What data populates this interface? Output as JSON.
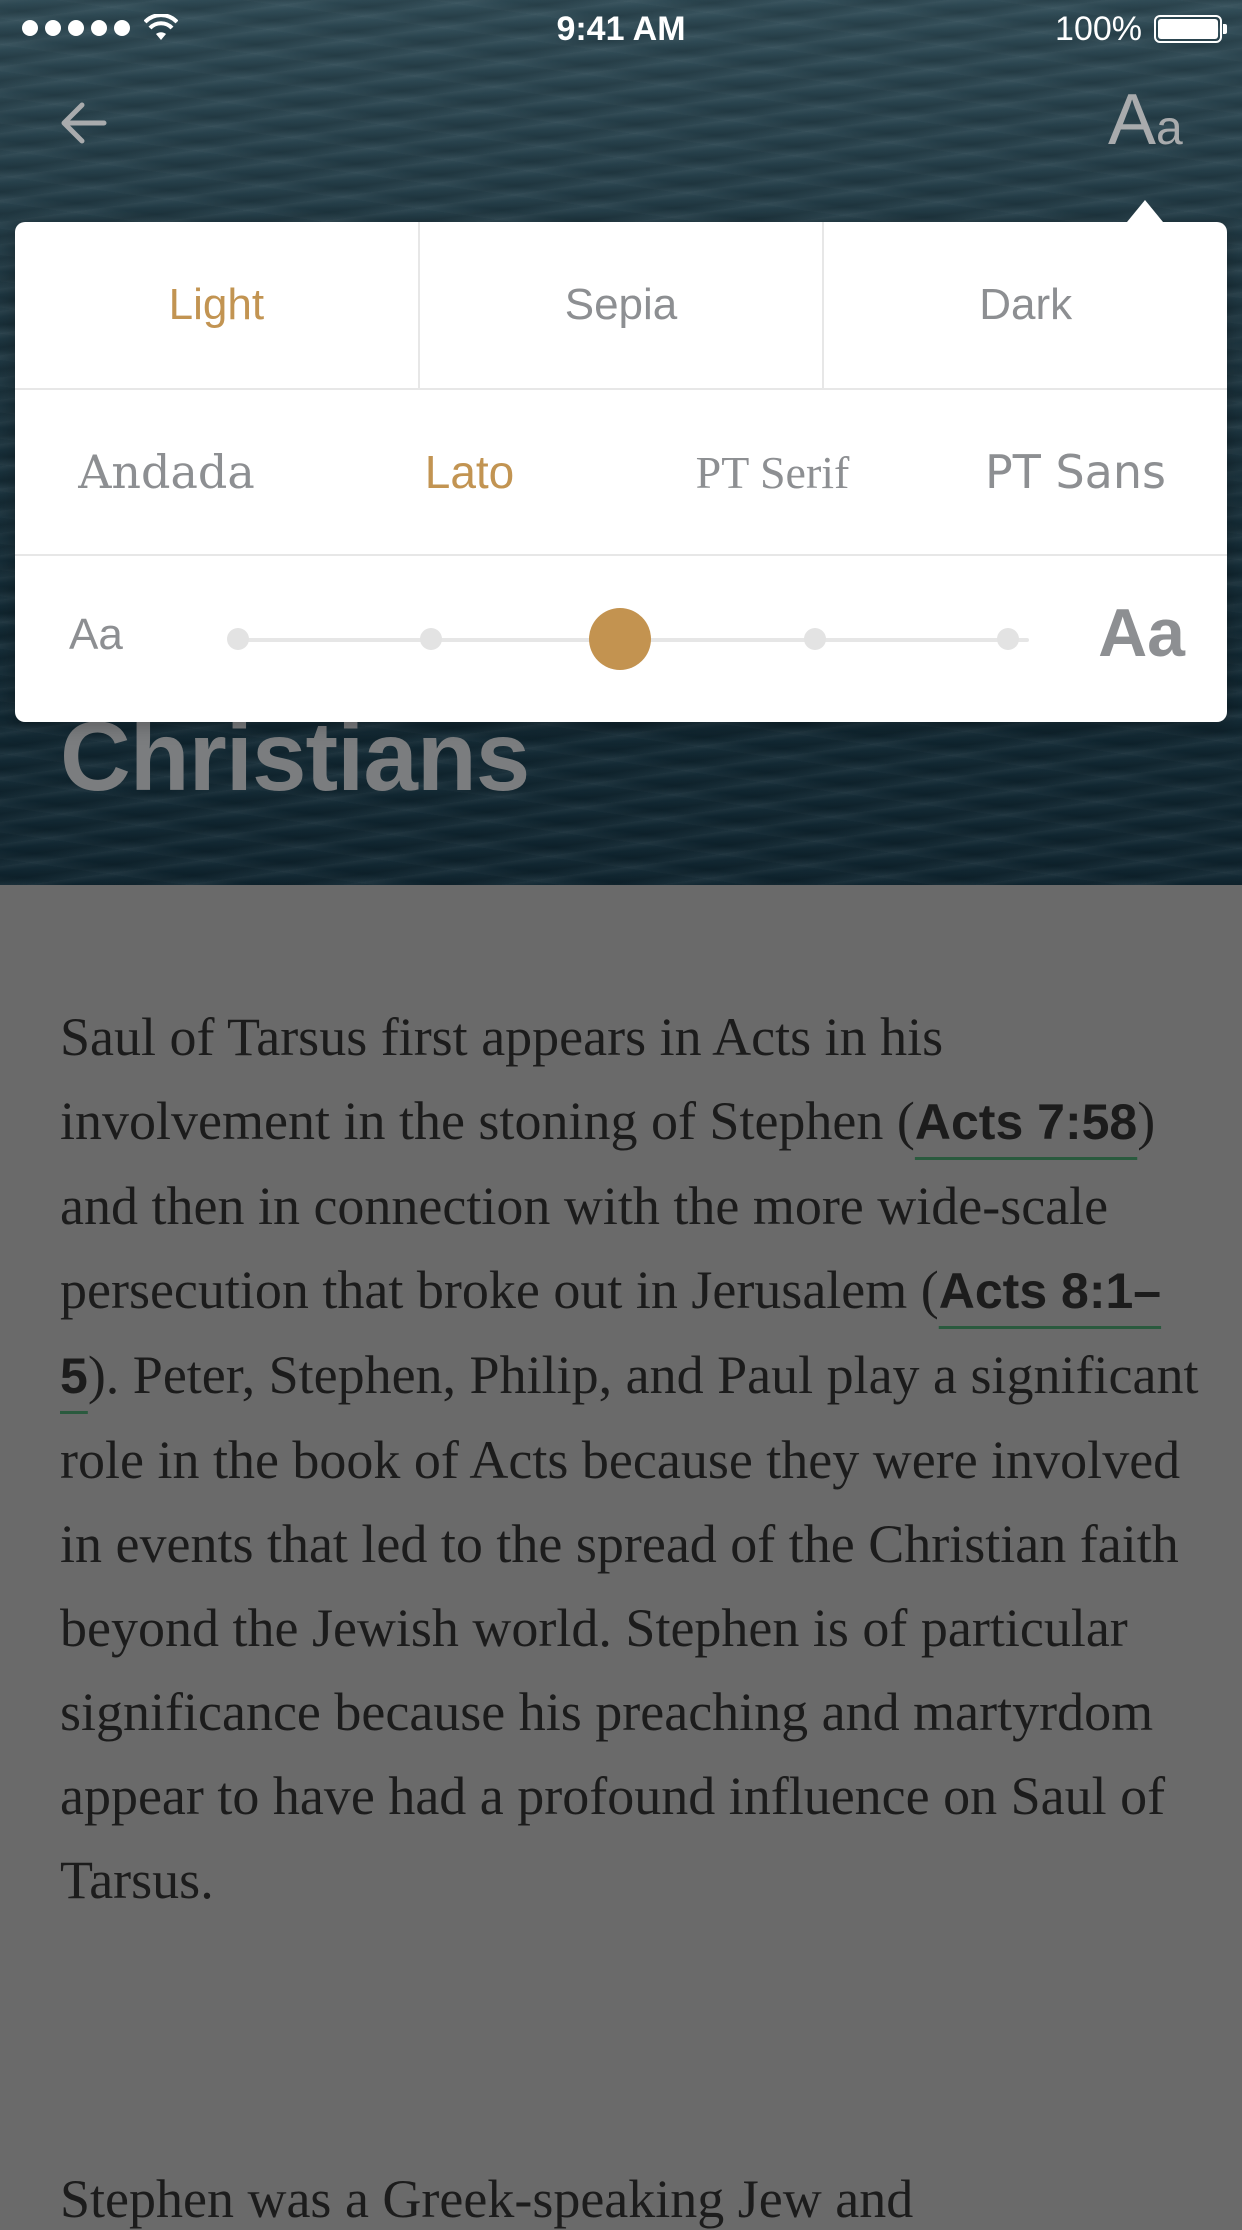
{
  "status_bar": {
    "time": "9:41 AM",
    "battery_pct": "100%"
  },
  "header": {
    "font_button_label_big": "A",
    "font_button_label_small": "a"
  },
  "hero": {
    "title": "Christians"
  },
  "settings": {
    "themes": [
      {
        "label": "Light",
        "active": true
      },
      {
        "label": "Sepia",
        "active": false
      },
      {
        "label": "Dark",
        "active": false
      }
    ],
    "fonts": [
      {
        "label": "Andada",
        "active": false
      },
      {
        "label": "Lato",
        "active": true
      },
      {
        "label": "PT Serif",
        "active": false
      },
      {
        "label": "PT Sans",
        "active": false
      }
    ],
    "size": {
      "small_label": "Aa",
      "large_label": "Aa",
      "steps": 5,
      "selected_step": 3
    },
    "accent_color": "#c29452"
  },
  "article": {
    "p1_a": "Saul of Tarsus first appears in Acts in his involvement in the stoning of Stephen (",
    "ref1": "Acts 7:58",
    "p1_b": ") and then in connection with the more wide-scale persecution that broke out in Jerusalem (",
    "ref2": "Acts 8:1–5",
    "p1_c": "). Peter, Stephen, Philip, and Paul play a significant role in the book of Acts because they were involved in events that led to the spread of the Christian faith beyond the Jewish world. Stephen is of particular significance because his preaching and martyrdom appear to have had a profound influence on Saul of Tarsus.",
    "p2_partial": "Stephen was a Greek-speaking Jew and"
  }
}
